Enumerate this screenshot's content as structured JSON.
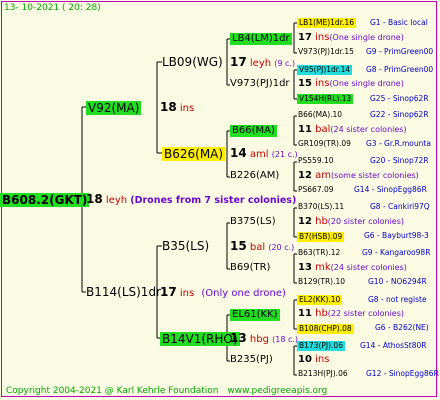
{
  "header": {
    "date": "13- 10-2021 ( 20: 28)"
  },
  "footer": {
    "copyright": "Copyright 2004-2021 @ Karl Kehrle Foundation",
    "site": "www.pedigreeapis.org"
  },
  "root": {
    "id": "B608.2(GKT)",
    "year": "18",
    "unit": "leyh",
    "note": "(Drones from 7 sister colonies)"
  },
  "sire": {
    "id": "V92(MA)",
    "year": "18",
    "unit": "ins"
  },
  "dam": {
    "id": "B114(LS)1dr",
    "year": "17",
    "unit": "ins",
    "note": "(Only one drone)"
  },
  "ss": {
    "id": "LB09(WG)",
    "year": "17",
    "unit": "leyh",
    "note": "(9 c.)"
  },
  "sd": {
    "id": "B626(MA)",
    "year": "14",
    "unit": "aml",
    "note": "(21 c.)"
  },
  "ds": {
    "id": "B35(LS)",
    "year": "15",
    "unit": "bal",
    "note": "(20 c.)"
  },
  "dd": {
    "id": "B14V1(RHO)",
    "year": "13",
    "unit": "hbg",
    "note": "(18 c.)"
  },
  "g3": [
    {
      "id": "LB4(LM)1dr",
      "year": "17",
      "unit": "ins",
      "note": "(One single drone)",
      "top": "LB1(ME)1dr.16",
      "topcode": "G1 - Basic local",
      "bot": "V973(PJ)1dr.15",
      "botcode": "G9 - PrimGreen00"
    },
    {
      "id": "V973(PJ)1dr",
      "year": "15",
      "unit": "ins",
      "note": "(One single drone)",
      "top": "V95(PJ)1dr.14",
      "topcode": "G8 - PrimGreen00",
      "bot": "V154H(RL).13",
      "botcode": "G25 - Sinop62R"
    },
    {
      "id": "B66(MA)",
      "year": "11",
      "unit": "bal",
      "note": "(24 sister colonies)",
      "top": "B66(MA).10",
      "topcode": "G22 - Sinop62R",
      "bot": "GR109(TR).09",
      "botcode": "G3 - Gr.R.mounta"
    },
    {
      "id": "B226(AM)",
      "year": "12",
      "unit": "am",
      "note": "(some sister colonies)",
      "top": "PS559.10",
      "topcode": "G20 - Sinop72R",
      "bot": "PS667.09",
      "botcode": "G14 - SinopEgg86R"
    },
    {
      "id": "B375(LS)",
      "year": "12",
      "unit": "hb",
      "note": "(20 sister colonies)",
      "top": "B370(LS).11",
      "topcode": "G8 - Cankiri97Q",
      "bot": "B7(HSB).09",
      "botcode": "G6 - Bayburt98-3"
    },
    {
      "id": "B69(TR)",
      "year": "13",
      "unit": "mk",
      "note": "(24 sister colonies)",
      "top": "B63(TR).12",
      "topcode": "G9 - Kangaroo98R",
      "bot": "B129(TR).10",
      "botcode": "G10 - NO6294R"
    },
    {
      "id": "EL61(KK)",
      "year": "11",
      "unit": "hb",
      "note": "(22 sister colonies)",
      "top": "EL2(KK).10",
      "topcode": "G8 - not registe",
      "bot": "B108(CHP).08",
      "botcode": "G6 - B262(NE)"
    },
    {
      "id": "B235(PJ)",
      "year": "10",
      "unit": "ins",
      "note": "",
      "top": "B173(PJ).06",
      "topcode": "G14 - AthosSt80R",
      "bot": "B213H(PJ).06",
      "botcode": "G12 - SinopEgg86R"
    }
  ],
  "colors": {
    "frame": "#c000c0",
    "green": "#22dd22",
    "yellow": "#ffee00",
    "cyan": "#22dddd",
    "line": "#000000",
    "code": "#0000cc",
    "unit": "#cc0000",
    "note": "#6a0ad0"
  }
}
